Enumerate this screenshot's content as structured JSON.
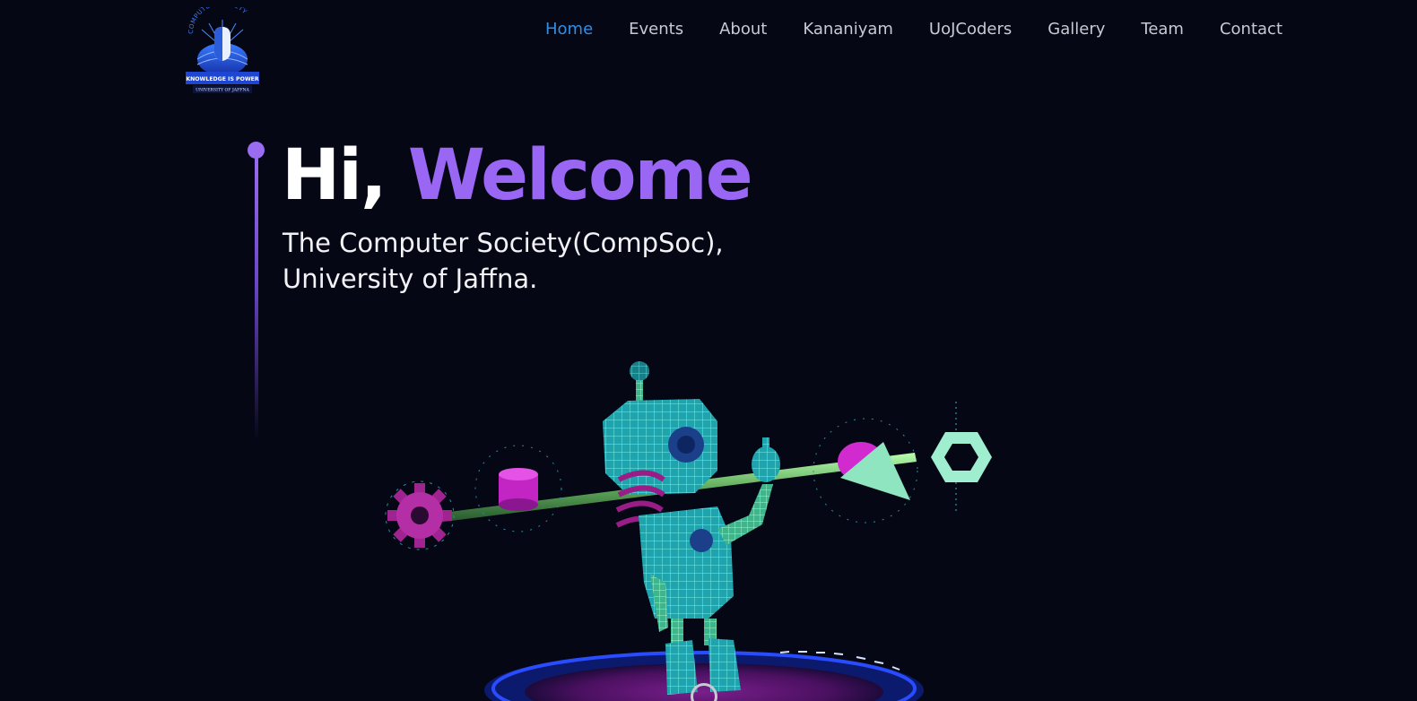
{
  "header": {
    "logo": {
      "arc_text": "COMPUTER SOCIETY",
      "motto": "KNOWLEDGE IS POWER",
      "institution": "UNIVERSITY OF JAFFNA"
    },
    "nav": [
      {
        "label": "Home",
        "active": true
      },
      {
        "label": "Events",
        "active": false
      },
      {
        "label": "About",
        "active": false
      },
      {
        "label": "Kananiyam",
        "active": false
      },
      {
        "label": "UoJCoders",
        "active": false
      },
      {
        "label": "Gallery",
        "active": false
      },
      {
        "label": "Team",
        "active": false
      },
      {
        "label": "Contact",
        "active": false
      }
    ]
  },
  "hero": {
    "greeting": "Hi,",
    "highlight": "Welcome",
    "subtitle_line1": "The Computer Society(CompSoc),",
    "subtitle_line2": "University of Jaffna."
  },
  "colors": {
    "background": "#050714",
    "accent": "#9a66f4",
    "nav_active": "#2f8fe8",
    "nav_text": "#c9c9d4",
    "robot": "#2ec4c0",
    "magenta": "#d02bd6",
    "mint": "#8ee6c2"
  },
  "icons": [
    "society-logo",
    "robot-3d-illustration",
    "gear-icon",
    "cylinder-shape",
    "cone-shape",
    "torus-ring-shape",
    "spring-shape",
    "scroll-indicator-icon"
  ]
}
